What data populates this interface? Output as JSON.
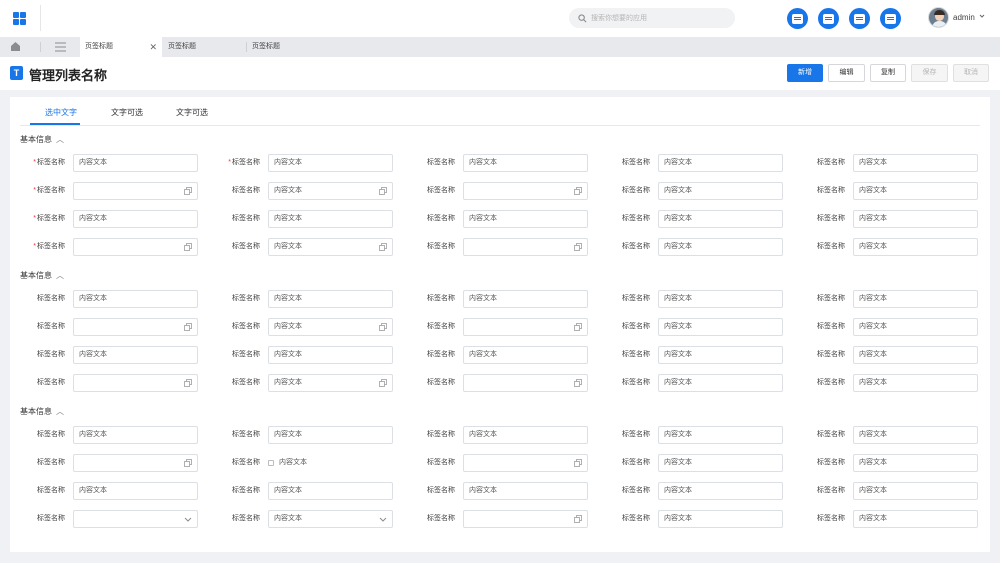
{
  "header": {
    "search_placeholder": "搜索你想要的应用",
    "username": "admin"
  },
  "tabbar": {
    "tabs": [
      "页签标题",
      "页签标题",
      "页签标题"
    ]
  },
  "page": {
    "title": "管理列表名称",
    "title_icon": "T",
    "buttons": {
      "add": "新增",
      "edit": "编辑",
      "copy": "复制",
      "save": "保存",
      "cancel": "取消"
    }
  },
  "content_tabs": [
    "选中文字",
    "文字可选",
    "文字可选"
  ],
  "form": {
    "sections": [
      {
        "title": "基本信息",
        "rows": [
          [
            {
              "label": "标签名称",
              "required": true,
              "type": "text",
              "value": "内容文本"
            },
            {
              "label": "标签名称",
              "required": true,
              "type": "text",
              "value": "内容文本"
            },
            {
              "label": "标签名称",
              "required": false,
              "type": "text",
              "value": "内容文本"
            },
            {
              "label": "标签名称",
              "required": false,
              "type": "text",
              "value": "内容文本"
            },
            {
              "label": "标签名称",
              "required": false,
              "type": "text",
              "value": "内容文本"
            }
          ],
          [
            {
              "label": "标签名称",
              "required": true,
              "type": "copy",
              "value": ""
            },
            {
              "label": "标签名称",
              "required": false,
              "type": "copy",
              "value": "内容文本"
            },
            {
              "label": "标签名称",
              "required": false,
              "type": "copy",
              "value": ""
            },
            {
              "label": "标签名称",
              "required": false,
              "type": "text",
              "value": "内容文本"
            },
            {
              "label": "标签名称",
              "required": false,
              "type": "text",
              "value": "内容文本"
            }
          ],
          [
            {
              "label": "标签名称",
              "required": true,
              "type": "text",
              "value": "内容文本"
            },
            {
              "label": "标签名称",
              "required": false,
              "type": "text",
              "value": "内容文本"
            },
            {
              "label": "标签名称",
              "required": false,
              "type": "text",
              "value": "内容文本"
            },
            {
              "label": "标签名称",
              "required": false,
              "type": "text",
              "value": "内容文本"
            },
            {
              "label": "标签名称",
              "required": false,
              "type": "text",
              "value": "内容文本"
            }
          ],
          [
            {
              "label": "标签名称",
              "required": true,
              "type": "copy",
              "value": ""
            },
            {
              "label": "标签名称",
              "required": false,
              "type": "copy",
              "value": "内容文本"
            },
            {
              "label": "标签名称",
              "required": false,
              "type": "copy",
              "value": ""
            },
            {
              "label": "标签名称",
              "required": false,
              "type": "text",
              "value": "内容文本"
            },
            {
              "label": "标签名称",
              "required": false,
              "type": "text",
              "value": "内容文本"
            }
          ]
        ]
      },
      {
        "title": "基本信息",
        "rows": [
          [
            {
              "label": "标签名称",
              "required": false,
              "type": "text",
              "value": "内容文本"
            },
            {
              "label": "标签名称",
              "required": false,
              "type": "text",
              "value": "内容文本"
            },
            {
              "label": "标签名称",
              "required": false,
              "type": "text",
              "value": "内容文本"
            },
            {
              "label": "标签名称",
              "required": false,
              "type": "text",
              "value": "内容文本"
            },
            {
              "label": "标签名称",
              "required": false,
              "type": "text",
              "value": "内容文本"
            }
          ],
          [
            {
              "label": "标签名称",
              "required": false,
              "type": "copy",
              "value": ""
            },
            {
              "label": "标签名称",
              "required": false,
              "type": "copy",
              "value": "内容文本"
            },
            {
              "label": "标签名称",
              "required": false,
              "type": "copy",
              "value": ""
            },
            {
              "label": "标签名称",
              "required": false,
              "type": "text",
              "value": "内容文本"
            },
            {
              "label": "标签名称",
              "required": false,
              "type": "text",
              "value": "内容文本"
            }
          ],
          [
            {
              "label": "标签名称",
              "required": false,
              "type": "text",
              "value": "内容文本"
            },
            {
              "label": "标签名称",
              "required": false,
              "type": "text",
              "value": "内容文本"
            },
            {
              "label": "标签名称",
              "required": false,
              "type": "text",
              "value": "内容文本"
            },
            {
              "label": "标签名称",
              "required": false,
              "type": "text",
              "value": "内容文本"
            },
            {
              "label": "标签名称",
              "required": false,
              "type": "text",
              "value": "内容文本"
            }
          ],
          [
            {
              "label": "标签名称",
              "required": false,
              "type": "copy",
              "value": ""
            },
            {
              "label": "标签名称",
              "required": false,
              "type": "copy",
              "value": "内容文本"
            },
            {
              "label": "标签名称",
              "required": false,
              "type": "copy",
              "value": ""
            },
            {
              "label": "标签名称",
              "required": false,
              "type": "text",
              "value": "内容文本"
            },
            {
              "label": "标签名称",
              "required": false,
              "type": "text",
              "value": "内容文本"
            }
          ]
        ]
      },
      {
        "title": "基本信息",
        "rows": [
          [
            {
              "label": "标签名称",
              "required": false,
              "type": "text",
              "value": "内容文本"
            },
            {
              "label": "标签名称",
              "required": false,
              "type": "text",
              "value": "内容文本"
            },
            {
              "label": "标签名称",
              "required": false,
              "type": "text",
              "value": "内容文本"
            },
            {
              "label": "标签名称",
              "required": false,
              "type": "text",
              "value": "内容文本"
            },
            {
              "label": "标签名称",
              "required": false,
              "type": "text",
              "value": "内容文本"
            }
          ],
          [
            {
              "label": "标签名称",
              "required": false,
              "type": "copy",
              "value": ""
            },
            {
              "label": "标签名称",
              "required": false,
              "type": "checkbox",
              "value": "内容文本"
            },
            {
              "label": "标签名称",
              "required": false,
              "type": "copy",
              "value": ""
            },
            {
              "label": "标签名称",
              "required": false,
              "type": "text",
              "value": "内容文本"
            },
            {
              "label": "标签名称",
              "required": false,
              "type": "text",
              "value": "内容文本"
            }
          ],
          [
            {
              "label": "标签名称",
              "required": false,
              "type": "text",
              "value": "内容文本"
            },
            {
              "label": "标签名称",
              "required": false,
              "type": "text",
              "value": "内容文本"
            },
            {
              "label": "标签名称",
              "required": false,
              "type": "text",
              "value": "内容文本"
            },
            {
              "label": "标签名称",
              "required": false,
              "type": "text",
              "value": "内容文本"
            },
            {
              "label": "标签名称",
              "required": false,
              "type": "text",
              "value": "内容文本"
            }
          ],
          [
            {
              "label": "标签名称",
              "required": false,
              "type": "select",
              "value": ""
            },
            {
              "label": "标签名称",
              "required": false,
              "type": "select",
              "value": "内容文本"
            },
            {
              "label": "标签名称",
              "required": false,
              "type": "copy",
              "value": ""
            },
            {
              "label": "标签名称",
              "required": false,
              "type": "text",
              "value": "内容文本"
            },
            {
              "label": "标签名称",
              "required": false,
              "type": "text",
              "value": "内容文本"
            }
          ]
        ]
      }
    ]
  },
  "colors": {
    "accent": "#1976e8",
    "required": "#e53935"
  }
}
